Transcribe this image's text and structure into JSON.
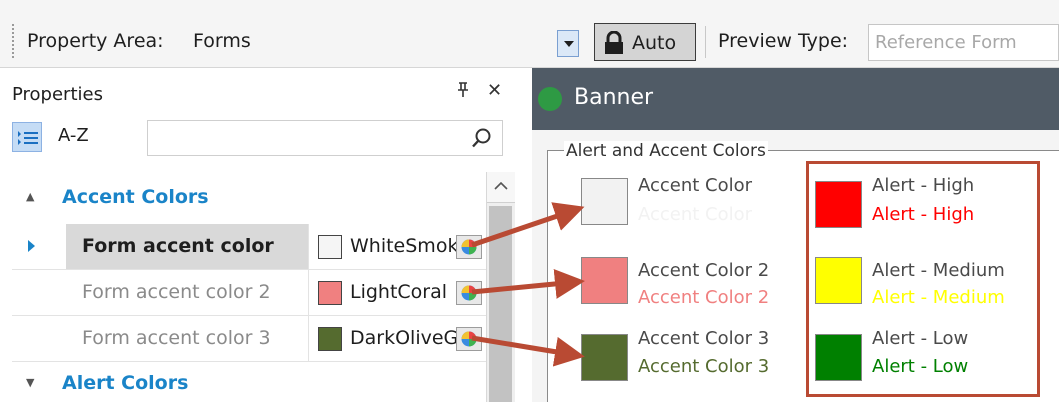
{
  "toolbar": {
    "property_area_label": "Property Area:",
    "property_area_value": "Forms",
    "auto_label": "Auto",
    "preview_type_label": "Preview Type:",
    "preview_type_value": "Reference Form"
  },
  "properties_panel": {
    "title": "Properties",
    "pin_glyph": "ᵖ",
    "close_glyph": "✕",
    "az_label": "A-Z",
    "search_placeholder": ""
  },
  "grid": {
    "categories": [
      {
        "label": "Accent Colors",
        "expanded": true
      },
      {
        "label": "Alert Colors",
        "expanded": false
      }
    ],
    "rows": [
      {
        "name": "Form accent color",
        "value": "WhiteSmoke",
        "color": "#f5f5f5",
        "selected": true
      },
      {
        "name": "Form accent color 2",
        "value": "LightCoral",
        "color": "#f08080",
        "selected": false
      },
      {
        "name": "Form accent color 3",
        "value": "DarkOliveGreen",
        "color": "#556b2f",
        "selected": false
      }
    ]
  },
  "preview": {
    "banner_title": "Banner",
    "banner_dot_color": "#2e9a44",
    "group_title": "Alert and Accent Colors",
    "accents": [
      {
        "label": "Accent Color",
        "colored_label": "Accent Color",
        "color": "#f2f2f2"
      },
      {
        "label": "Accent Color 2",
        "colored_label": "Accent Color 2",
        "color": "#f08080"
      },
      {
        "label": "Accent Color 3",
        "colored_label": "Accent Color 3",
        "color": "#556b2f"
      }
    ],
    "alerts": [
      {
        "label": "Alert - High",
        "colored_label": "Alert - High",
        "color": "#ff0000"
      },
      {
        "label": "Alert - Medium",
        "colored_label": "Alert - Medium",
        "color": "#ffff00"
      },
      {
        "label": "Alert - Low",
        "colored_label": "Alert - Low",
        "color": "#008000"
      }
    ]
  },
  "colors": {
    "category_text": "#1a84c8",
    "annotation_arrow": "#b94a33",
    "selection_marker": "#1a84c8"
  }
}
